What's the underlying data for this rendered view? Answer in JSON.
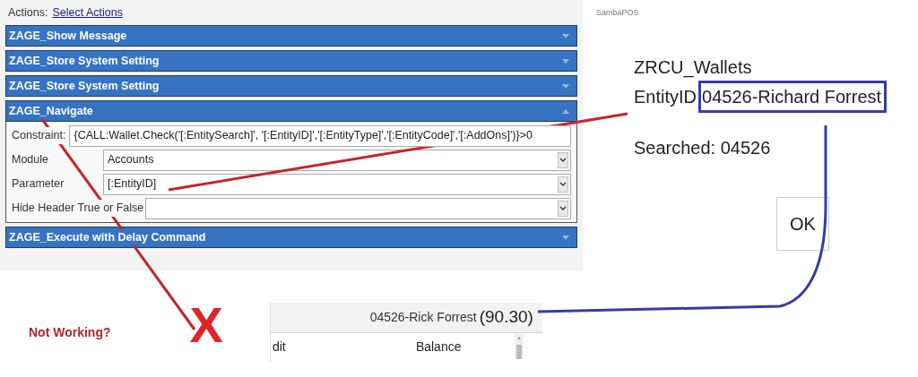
{
  "actions_header": {
    "label": "Actions:",
    "link": "Select Actions"
  },
  "actions": [
    {
      "title": "ZAGE_Show Message",
      "expanded": false
    },
    {
      "title": "ZAGE_Store System Setting",
      "expanded": false
    },
    {
      "title": "ZAGE_Store System Setting",
      "expanded": false
    },
    {
      "title": "ZAGE_Navigate",
      "expanded": true,
      "fields": [
        {
          "kind": "text",
          "label": "Constraint:",
          "value": "{CALL:Wallet.Check('[:EntitySearch]', '[:EntityID]','[:EntityType]','[:EntityCode]','[:AddOns]')}>0"
        },
        {
          "kind": "select",
          "label": "Module",
          "value": "Accounts"
        },
        {
          "kind": "select",
          "label": "Parameter",
          "value": "[:EntityID]"
        },
        {
          "kind": "select",
          "label": "Hide Header True or False"
        }
      ]
    },
    {
      "title": "ZAGE_Execute with Delay Command",
      "expanded": false
    }
  ],
  "app_title": "SambaPOS",
  "dialog": {
    "title": "ZRCU_Wallets",
    "entity_label": "EntityID",
    "entity_value": "04526-Richard Forrest",
    "searched": "Searched: 04526",
    "ok_button": "OK"
  },
  "note": {
    "text": "Not Working?",
    "mark": "X"
  },
  "account_panel": {
    "name": "04526-Rick Forrest",
    "balance": "(90.30)",
    "columns": [
      "dit",
      "Balance"
    ]
  }
}
